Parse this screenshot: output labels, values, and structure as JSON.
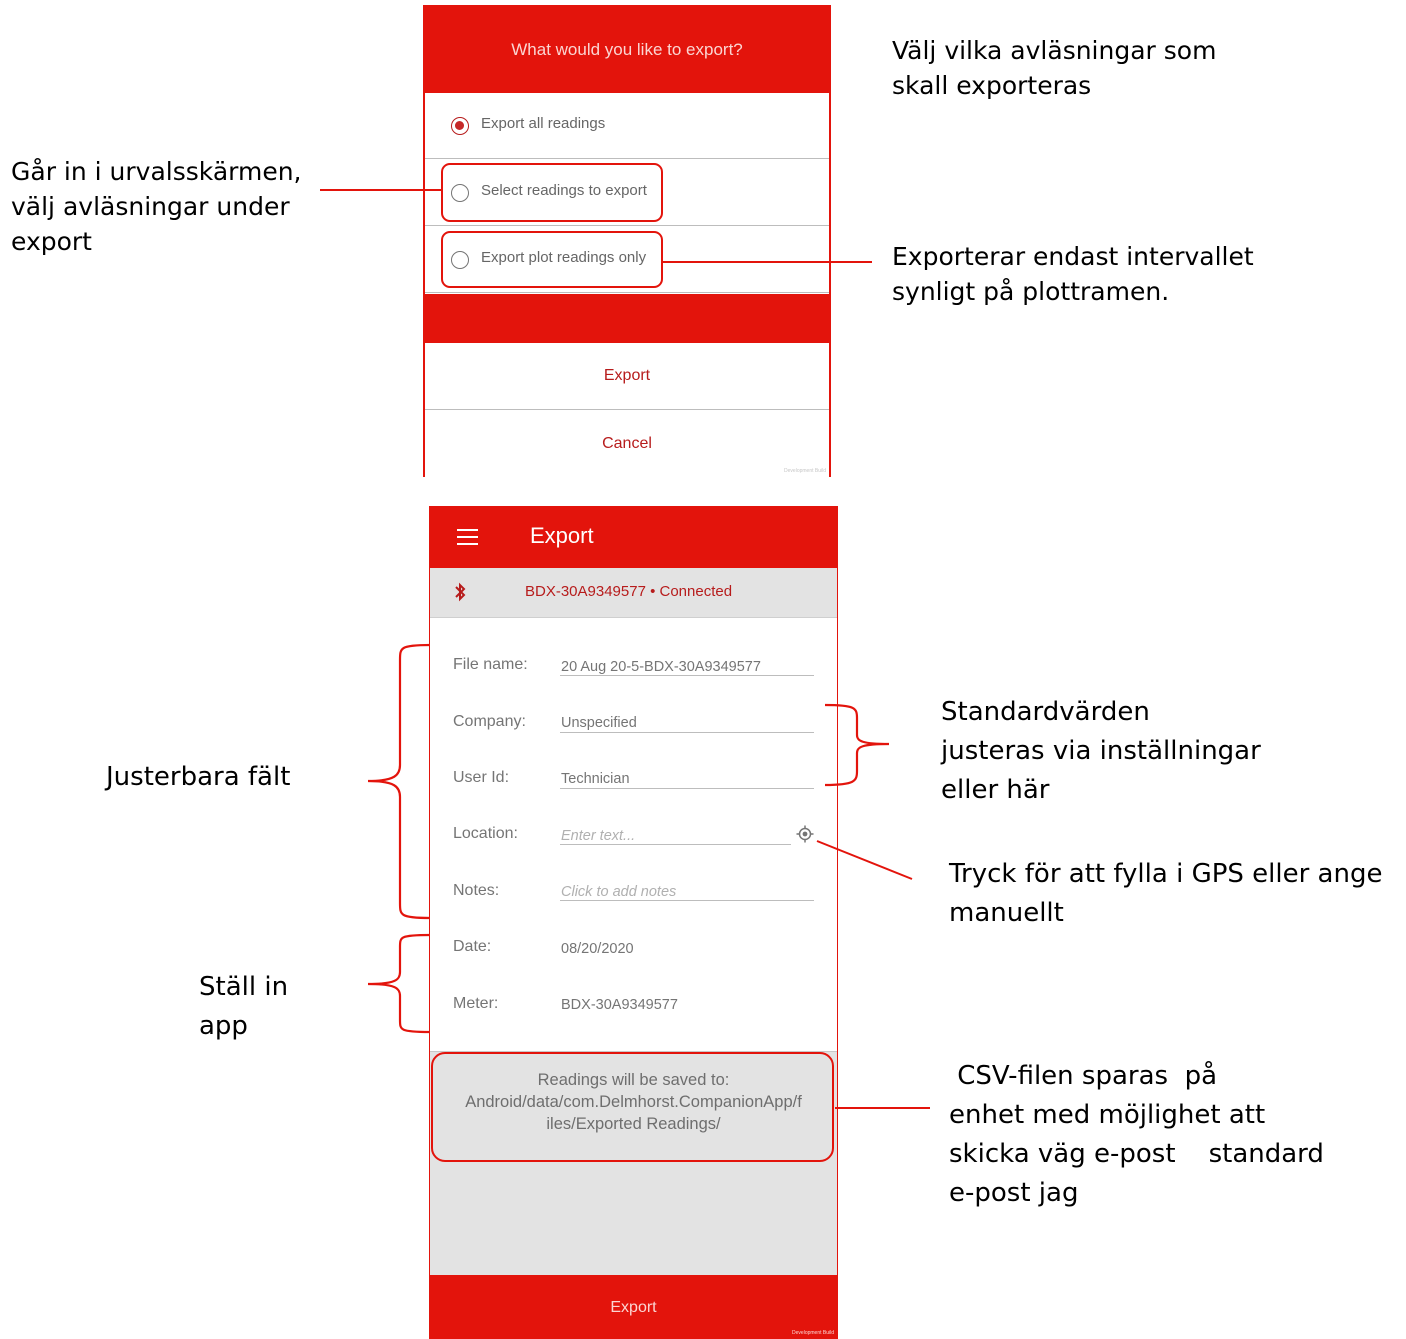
{
  "dialog": {
    "title": "What would you like to export?",
    "options": [
      {
        "label": "Export all readings",
        "selected": true
      },
      {
        "label": "Select readings to export",
        "selected": false
      },
      {
        "label": "Export plot readings only",
        "selected": false
      }
    ],
    "export_label": "Export",
    "cancel_label": "Cancel",
    "build_tag": "Development Build"
  },
  "screen": {
    "title": "Export",
    "device_status": "BDX-30A9349577 • Connected",
    "fields": {
      "file_name": {
        "label": "File name:",
        "value": "20 Aug 20-5-BDX-30A9349577"
      },
      "company": {
        "label": "Company:",
        "value": "Unspecified"
      },
      "user_id": {
        "label": "User Id:",
        "value": "Technician"
      },
      "location": {
        "label": "Location:",
        "placeholder": "Enter text..."
      },
      "notes": {
        "label": "Notes:",
        "placeholder": "Click to add notes"
      },
      "date": {
        "label": "Date:",
        "value": "08/20/2020"
      },
      "meter": {
        "label": "Meter:",
        "value": "BDX-30A9349577"
      }
    },
    "save_path": {
      "line1": "Readings will be saved to:",
      "line2": "Android/data/com.Delmhorst.CompanionApp/f",
      "line3": "iles/Exported Readings/"
    },
    "export_button": "Export",
    "build_tag": "Development Build"
  },
  "annotations": {
    "choose_readings": "Välj vilka avläsningar som\nskall exporteras",
    "selection_screen": "Går in i urvalsskärmen,\nvälj avläsningar under\nexport",
    "plot_only": "Exporterar endast intervallet\nsynligt på plottramen.",
    "adjustable_fields": "Justerbara fält",
    "defaults": "Standardvärden\njusteras via inställningar\neller här",
    "gps": "Tryck för att fylla i GPS eller ange\nmanuellt",
    "set_in_app": "Ställ in\napp",
    "csv_saved": " CSV-filen sparas  på\nenhet med möjlighet att\nskicka väg e-post    standard\ne-post jag"
  },
  "colors": {
    "accent": "#e3140c",
    "accent_dark": "#b71c1c",
    "panel_gray": "#e3e3e3"
  }
}
